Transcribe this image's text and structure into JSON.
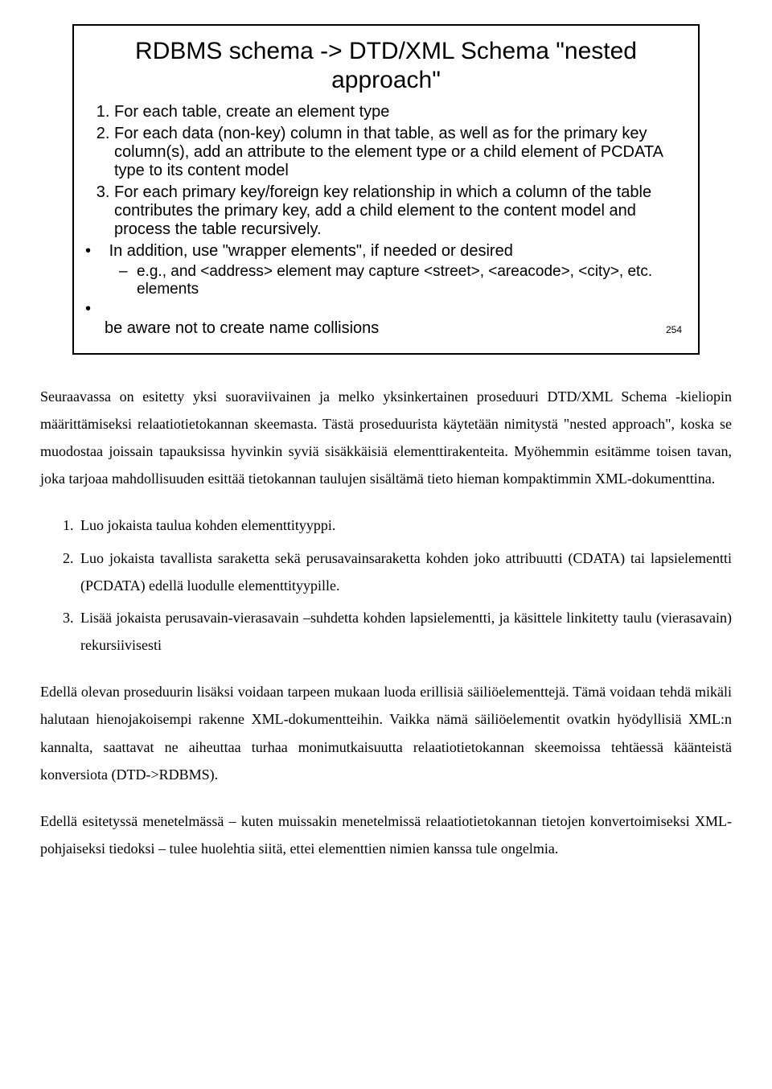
{
  "slide": {
    "title": "RDBMS schema -> DTD/XML Schema \"nested approach\"",
    "items": [
      "For each table, create an element type",
      "For each data (non-key) column in that table, as well as for the primary key column(s), add an attribute to the element type or a child element of PCDATA type to its content model",
      "For each primary key/foreign key relationship in which a column of the table contributes the primary key, add a child element to the content model and process the table recursively."
    ],
    "bullets": {
      "b1": "In addition, use \"wrapper elements\", if needed or desired",
      "b1sub": "e.g., and <address> element may capture <street>, <areacode>, <city>, etc. elements",
      "b2": "be aware not to create name collisions"
    },
    "number": "254"
  },
  "paragraphs": {
    "p1": "Seuraavassa on esitetty yksi suoraviivainen ja melko yksinkertainen proseduuri DTD/XML Schema -kieliopin määrittämiseksi relaatiotietokannan skeemasta. Tästä proseduurista käytetään nimitystä \"nested approach\", koska se muodostaa joissain tapauksissa hyvinkin syviä sisäkkäisiä elementtirakenteita. Myöhemmin esitämme toisen tavan, joka tarjoaa mahdollisuuden esittää tietokannan taulujen sisältämä tieto hieman kompaktimmin XML-dokumenttina.",
    "list": [
      "Luo jokaista taulua kohden elementtityyppi.",
      "Luo jokaista tavallista saraketta sekä perusavainsaraketta kohden joko attribuutti (CDATA) tai lapsielementti (PCDATA) edellä luodulle elementtityypille.",
      "Lisää jokaista perusavain-vierasavain –suhdetta kohden lapsielementti, ja käsittele linkitetty taulu (vierasavain) rekursiivisesti"
    ],
    "p2": "Edellä olevan proseduurin lisäksi voidaan tarpeen mukaan luoda erillisiä säiliöelementtejä. Tämä voidaan tehdä mikäli halutaan hienojakoisempi rakenne XML-dokumentteihin. Vaikka nämä säiliöelementit ovatkin hyödyllisiä XML:n kannalta, saattavat ne aiheuttaa turhaa monimutkaisuutta relaatiotietokannan skeemoissa tehtäessä käänteistä konversiota (DTD->RDBMS).",
    "p3": "Edellä esitetyssä menetelmässä – kuten muissakin menetelmissä relaatiotietokannan tietojen konvertoimiseksi XML-pohjaiseksi tiedoksi – tulee huolehtia siitä, ettei elementtien nimien kanssa tule ongelmia."
  }
}
